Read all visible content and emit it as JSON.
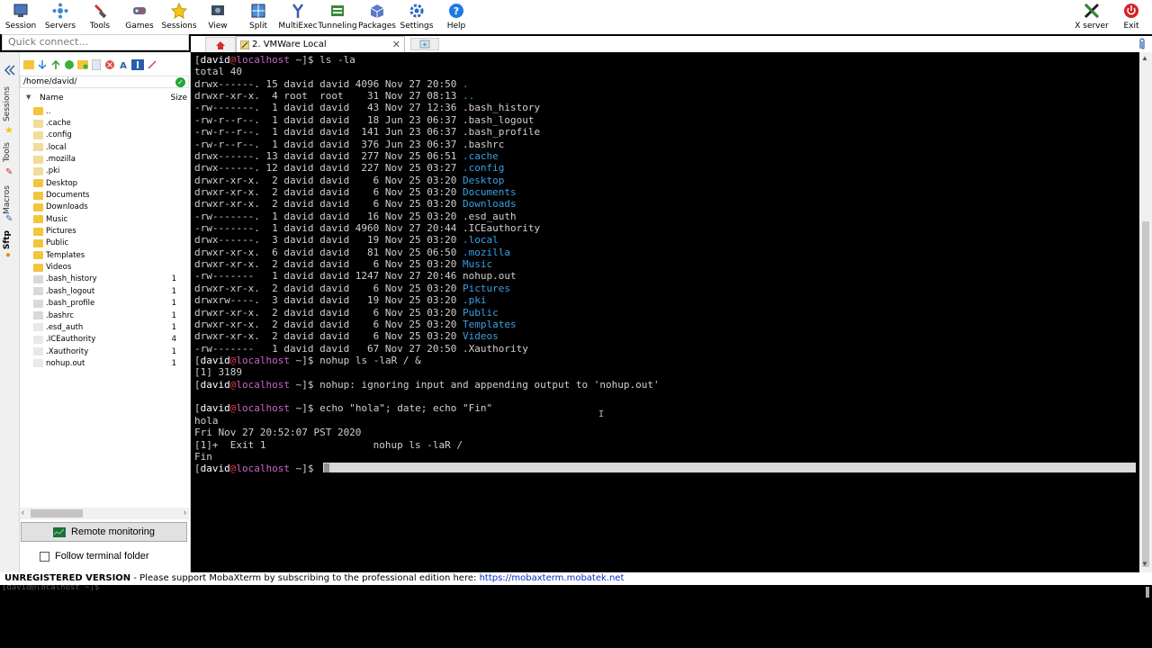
{
  "toolbar": {
    "session": "Session",
    "servers": "Servers",
    "tools": "Tools",
    "games": "Games",
    "sessions": "Sessions",
    "view": "View",
    "split": "Split",
    "multiexec": "MultiExec",
    "tunneling": "Tunneling",
    "packages": "Packages",
    "settings": "Settings",
    "help": "Help",
    "xserver": "X server",
    "exit": "Exit"
  },
  "quick_connect": {
    "placeholder": "Quick connect..."
  },
  "tabs": {
    "session_tab_label": "2. VMWare Local"
  },
  "left_strip": {
    "sessions": "Sessions",
    "tools": "Tools",
    "macros": "Macros",
    "sftp": "Sftp"
  },
  "sftp": {
    "path": "/home/david/",
    "col_name": "Name",
    "col_size": "Size",
    "files": [
      {
        "name": "..",
        "size": "",
        "kind": "up"
      },
      {
        "name": ".cache",
        "size": "",
        "kind": "folder-hidden"
      },
      {
        "name": ".config",
        "size": "",
        "kind": "folder-hidden"
      },
      {
        "name": ".local",
        "size": "",
        "kind": "folder-hidden"
      },
      {
        "name": ".mozilla",
        "size": "",
        "kind": "folder-hidden"
      },
      {
        "name": ".pki",
        "size": "",
        "kind": "folder-hidden"
      },
      {
        "name": "Desktop",
        "size": "",
        "kind": "folder"
      },
      {
        "name": "Documents",
        "size": "",
        "kind": "folder"
      },
      {
        "name": "Downloads",
        "size": "",
        "kind": "folder"
      },
      {
        "name": "Music",
        "size": "",
        "kind": "folder"
      },
      {
        "name": "Pictures",
        "size": "",
        "kind": "folder"
      },
      {
        "name": "Public",
        "size": "",
        "kind": "folder"
      },
      {
        "name": "Templates",
        "size": "",
        "kind": "folder"
      },
      {
        "name": "Videos",
        "size": "",
        "kind": "folder"
      },
      {
        "name": ".bash_history",
        "size": "1",
        "kind": "file"
      },
      {
        "name": ".bash_logout",
        "size": "1",
        "kind": "file"
      },
      {
        "name": ".bash_profile",
        "size": "1",
        "kind": "file"
      },
      {
        "name": ".bashrc",
        "size": "1",
        "kind": "file"
      },
      {
        "name": ".esd_auth",
        "size": "1",
        "kind": "file-hidden"
      },
      {
        "name": ".ICEauthority",
        "size": "4",
        "kind": "file-hidden"
      },
      {
        "name": ".Xauthority",
        "size": "1",
        "kind": "file-hidden"
      },
      {
        "name": "nohup.out",
        "size": "1",
        "kind": "file-hidden"
      }
    ],
    "remote_monitoring": "Remote monitoring",
    "follow_terminal": "Follow terminal folder"
  },
  "terminal": {
    "user": "david",
    "host": "localhost",
    "cwd": "~",
    "lines": [
      {
        "prompt": true,
        "cmd": "ls -la"
      },
      {
        "text": "total 40"
      },
      {
        "text": "drwx------. 15 david david 4096 Nov 27 20:50 ",
        "name": ".",
        "color": "dir"
      },
      {
        "text": "drwxr-xr-x.  4 root  root    31 Nov 27 08:13 ",
        "name": "..",
        "color": "dir"
      },
      {
        "text": "-rw-------.  1 david david   43 Nov 27 12:36 ",
        "name": ".bash_history",
        "color": "file"
      },
      {
        "text": "-rw-r--r--.  1 david david   18 Jun 23 06:37 ",
        "name": ".bash_logout",
        "color": "file"
      },
      {
        "text": "-rw-r--r--.  1 david david  141 Jun 23 06:37 ",
        "name": ".bash_profile",
        "color": "file"
      },
      {
        "text": "-rw-r--r--.  1 david david  376 Jun 23 06:37 ",
        "name": ".bashrc",
        "color": "file"
      },
      {
        "text": "drwx------. 13 david david  277 Nov 25 06:51 ",
        "name": ".cache",
        "color": "dir"
      },
      {
        "text": "drwx------. 12 david david  227 Nov 25 03:27 ",
        "name": ".config",
        "color": "dir"
      },
      {
        "text": "drwxr-xr-x.  2 david david    6 Nov 25 03:20 ",
        "name": "Desktop",
        "color": "dir"
      },
      {
        "text": "drwxr-xr-x.  2 david david    6 Nov 25 03:20 ",
        "name": "Documents",
        "color": "dir"
      },
      {
        "text": "drwxr-xr-x.  2 david david    6 Nov 25 03:20 ",
        "name": "Downloads",
        "color": "dir"
      },
      {
        "text": "-rw-------.  1 david david   16 Nov 25 03:20 ",
        "name": ".esd_auth",
        "color": "file"
      },
      {
        "text": "-rw-------.  1 david david 4960 Nov 27 20:44 ",
        "name": ".ICEauthority",
        "color": "file"
      },
      {
        "text": "drwx------.  3 david david   19 Nov 25 03:20 ",
        "name": ".local",
        "color": "dir"
      },
      {
        "text": "drwxr-xr-x.  6 david david   81 Nov 25 06:50 ",
        "name": ".mozilla",
        "color": "dir"
      },
      {
        "text": "drwxr-xr-x.  2 david david    6 Nov 25 03:20 ",
        "name": "Music",
        "color": "dir"
      },
      {
        "text": "-rw-------   1 david david 1247 Nov 27 20:46 ",
        "name": "nohup.out",
        "color": "file"
      },
      {
        "text": "drwxr-xr-x.  2 david david    6 Nov 25 03:20 ",
        "name": "Pictures",
        "color": "dir"
      },
      {
        "text": "drwxrw----.  3 david david   19 Nov 25 03:20 ",
        "name": ".pki",
        "color": "dir"
      },
      {
        "text": "drwxr-xr-x.  2 david david    6 Nov 25 03:20 ",
        "name": "Public",
        "color": "dir"
      },
      {
        "text": "drwxr-xr-x.  2 david david    6 Nov 25 03:20 ",
        "name": "Templates",
        "color": "dir"
      },
      {
        "text": "drwxr-xr-x.  2 david david    6 Nov 25 03:20 ",
        "name": "Videos",
        "color": "dir"
      },
      {
        "text": "-rw-------   1 david david   67 Nov 27 20:50 ",
        "name": ".Xauthority",
        "color": "file"
      },
      {
        "prompt": true,
        "cmd": "nohup ls -laR / &"
      },
      {
        "text": "[1] 3189"
      },
      {
        "prompt": true,
        "cmd": "nohup: ignoring input and appending output to 'nohup.out'"
      },
      {
        "text": ""
      },
      {
        "prompt": true,
        "cmd": "echo \"hola\"; date; echo \"Fin\""
      },
      {
        "text": "hola"
      },
      {
        "text": "Fri Nov 27 20:52:07 PST 2020"
      },
      {
        "text": "[1]+  Exit 1                  nohup ls -laR /"
      },
      {
        "text": "Fin"
      },
      {
        "prompt": true,
        "cmd": ""
      }
    ]
  },
  "status": {
    "unregistered": "UNREGISTERED VERSION",
    "message": " -  Please support MobaXterm by subscribing to the professional edition here: ",
    "link": "https://mobaxterm.mobatek.net"
  },
  "bottom_text": "[david@localhost ~]$",
  "colors": {
    "dir": "#3aa0e6",
    "file": "#d0d0d0",
    "user": "#ffffff",
    "at": "#e03d3d",
    "host": "#c768c7"
  }
}
